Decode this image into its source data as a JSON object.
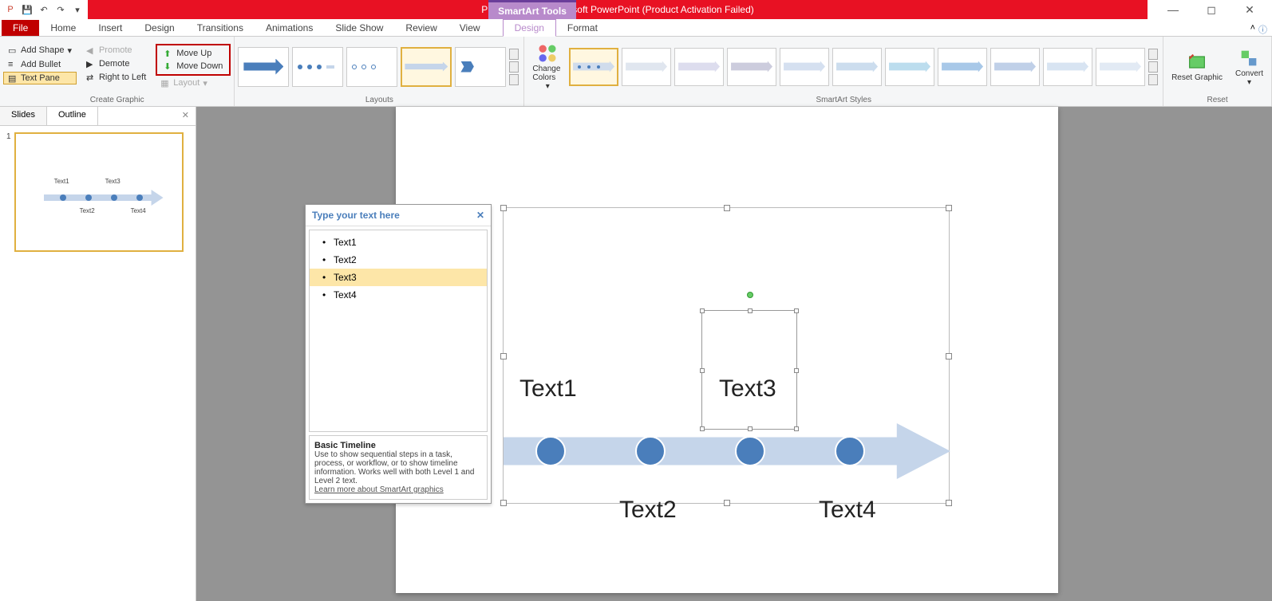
{
  "title": "Presentation1 - Microsoft PowerPoint (Product Activation Failed)",
  "smartart_tools": "SmartArt Tools",
  "tabs": {
    "file": "File",
    "home": "Home",
    "insert": "Insert",
    "design": "Design",
    "transitions": "Transitions",
    "animations": "Animations",
    "slideshow": "Slide Show",
    "review": "Review",
    "view": "View",
    "sa_design": "Design",
    "format": "Format"
  },
  "ribbon": {
    "create_graphic": {
      "add_shape": "Add Shape",
      "add_bullet": "Add Bullet",
      "text_pane": "Text Pane",
      "promote": "Promote",
      "demote": "Demote",
      "right_to_left": "Right to Left",
      "move_up": "Move Up",
      "move_down": "Move Down",
      "layout": "Layout",
      "group_label": "Create Graphic"
    },
    "layouts": {
      "group_label": "Layouts"
    },
    "change_colors": "Change Colors",
    "styles": {
      "group_label": "SmartArt Styles"
    },
    "reset": {
      "reset_graphic": "Reset Graphic",
      "convert": "Convert",
      "group_label": "Reset"
    }
  },
  "slidepane": {
    "slides_tab": "Slides",
    "outline_tab": "Outline",
    "slide_num": "1"
  },
  "textpane": {
    "header": "Type your text here",
    "items": [
      "Text1",
      "Text2",
      "Text3",
      "Text4"
    ],
    "selected_index": 2,
    "desc_title": "Basic Timeline",
    "desc_body": "Use to show sequential steps in a task, process, or workflow, or to show timeline information. Works well with both Level 1 and Level 2 text.",
    "learn_link": "Learn more about SmartArt graphics"
  },
  "smartart": {
    "texts": [
      "Text1",
      "Text2",
      "Text3",
      "Text4"
    ]
  }
}
